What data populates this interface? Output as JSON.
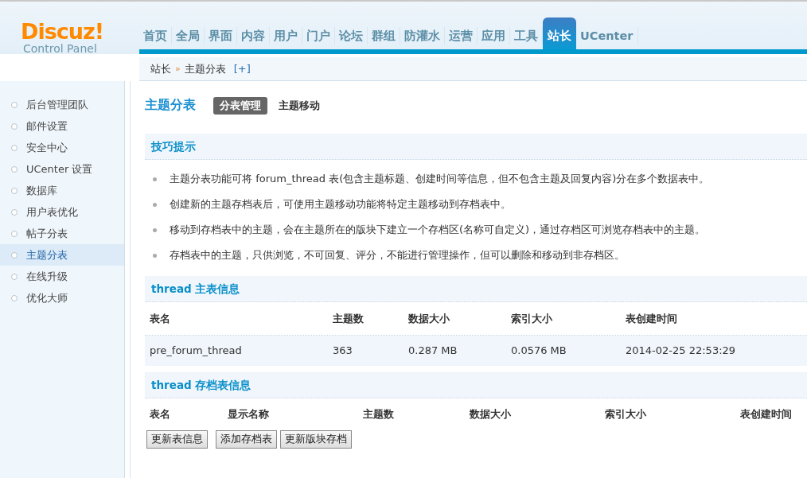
{
  "logo": {
    "title": "Discuz!",
    "subtitle": "Control Panel"
  },
  "nav": [
    {
      "label": "首页",
      "selected": false
    },
    {
      "label": "全局",
      "selected": false
    },
    {
      "label": "界面",
      "selected": false
    },
    {
      "label": "内容",
      "selected": false
    },
    {
      "label": "用户",
      "selected": false
    },
    {
      "label": "门户",
      "selected": false
    },
    {
      "label": "论坛",
      "selected": false
    },
    {
      "label": "群组",
      "selected": false
    },
    {
      "label": "防灌水",
      "selected": false
    },
    {
      "label": "运营",
      "selected": false
    },
    {
      "label": "应用",
      "selected": false
    },
    {
      "label": "工具",
      "selected": false
    },
    {
      "label": "站长",
      "selected": true
    },
    {
      "label": "UCenter",
      "selected": false
    }
  ],
  "breadcrumb": {
    "items": [
      "站长",
      "主题分表"
    ],
    "separator": "»",
    "toggle": "[+]"
  },
  "sidebar": {
    "items": [
      {
        "label": "后台管理团队",
        "selected": false
      },
      {
        "label": "邮件设置",
        "selected": false
      },
      {
        "label": "安全中心",
        "selected": false
      },
      {
        "label": "UCenter 设置",
        "selected": false
      },
      {
        "label": "数据库",
        "selected": false
      },
      {
        "label": "用户表优化",
        "selected": false
      },
      {
        "label": "帖子分表",
        "selected": false
      },
      {
        "label": "主题分表",
        "selected": true
      },
      {
        "label": "在线升级",
        "selected": false
      },
      {
        "label": "优化大师",
        "selected": false
      }
    ]
  },
  "page": {
    "title": "主题分表",
    "tabs": [
      {
        "label": "分表管理",
        "selected": true
      },
      {
        "label": "主题移动",
        "selected": false
      }
    ]
  },
  "tips": {
    "title": "技巧提示",
    "items": [
      "主题分表功能可将 forum_thread 表(包含主题标题、创建时间等信息，但不包含主题及回复内容)分在多个数据表中。",
      "创建新的主题存档表后，可使用主题移动功能将特定主题移动到存档表中。",
      "移动到存档表中的主题，会在主题所在的版块下建立一个存档区(名称可自定义)，通过存档区可浏览存档表中的主题。",
      "存档表中的主题，只供浏览，不可回复、评分，不能进行管理操作，但可以删除和移动到非存档区。"
    ]
  },
  "main_table": {
    "title": "thread 主表信息",
    "columns": [
      "表名",
      "主题数",
      "数据大小",
      "索引大小",
      "表创建时间"
    ],
    "rows": [
      [
        "pre_forum_thread",
        "363",
        "0.287 MB",
        "0.0576 MB",
        "2014-02-25 22:53:29"
      ]
    ]
  },
  "archive_table": {
    "title": "thread 存档表信息",
    "columns": [
      "表名",
      "显示名称",
      "主题数",
      "数据大小",
      "索引大小",
      "表创建时间"
    ],
    "buttons": [
      "更新表信息",
      "添加存档表",
      "更新版块存档"
    ]
  }
}
